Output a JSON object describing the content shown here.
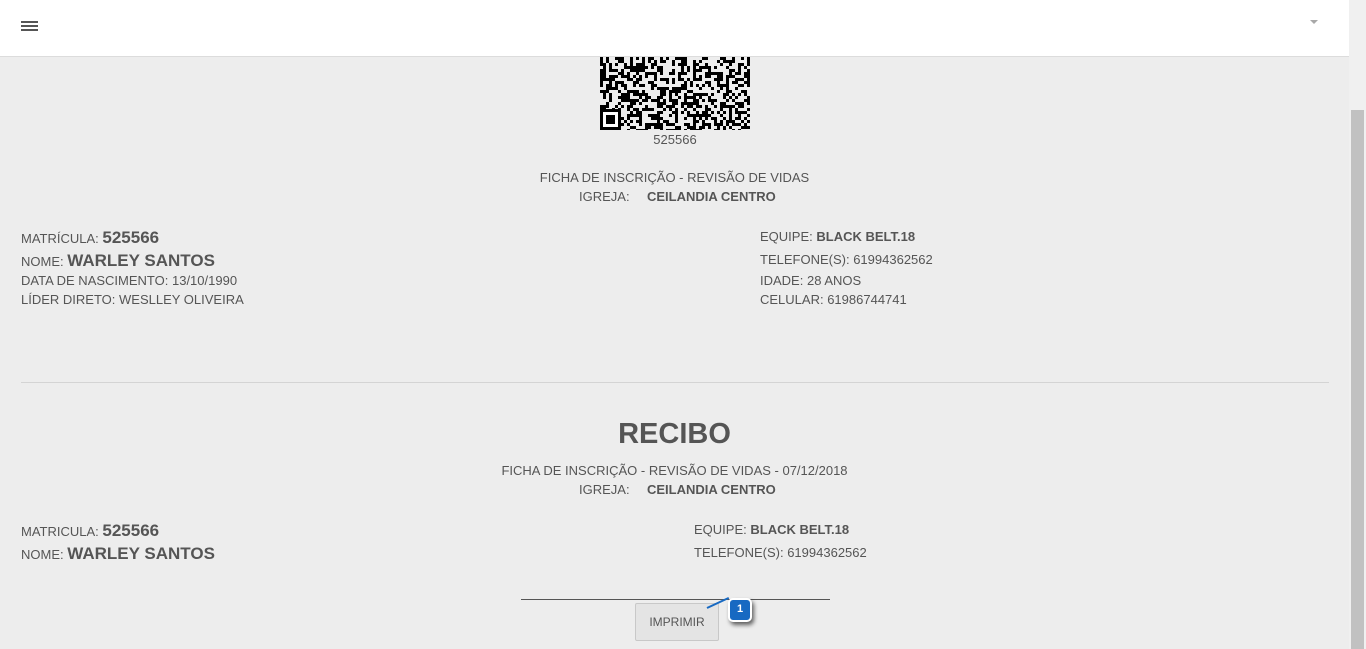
{
  "header": {
    "menu_icon": "hamburger-menu-icon",
    "dropdown_icon": "caret-down-icon"
  },
  "ficha": {
    "qr_code_number": "525566",
    "title": "FICHA DE INSCRIÇÃO - REVISÃO DE VIDAS",
    "igreja_label": "IGREJA:",
    "igreja_value": "CEILANDIA CENTRO",
    "matricula_label": "MATRÍCULA:",
    "matricula_value": "525566",
    "nome_label": "NOME:",
    "nome_value": "WARLEY SANTOS",
    "nascimento_label": "DATA DE NASCIMENTO:",
    "nascimento_value": "13/10/1990",
    "lider_label": "LÍDER DIRETO:",
    "lider_value": "WESLLEY OLIVEIRA",
    "equipe_label": "EQUIPE:",
    "equipe_value": "BLACK BELT.18",
    "telefone_label": "TELEFONE(S):",
    "telefone_value": "61994362562",
    "idade_label": "IDADE:",
    "idade_value": "28 ANOS",
    "celular_label": "CELULAR:",
    "celular_value": "61986744741"
  },
  "recibo": {
    "title": "RECIBO",
    "subtitle": "FICHA DE INSCRIÇÃO - REVISÃO DE VIDAS - 07/12/2018",
    "igreja_label": "IGREJA:",
    "igreja_value": "CEILANDIA CENTRO",
    "matricula_label": "MATRICULA:",
    "matricula_value": "525566",
    "nome_label": "NOME:",
    "nome_value": "WARLEY SANTOS",
    "equipe_label": "EQUIPE:",
    "equipe_value": "BLACK BELT.18",
    "telefone_label": "TELEFONE(S):",
    "telefone_value": "61994362562",
    "print_button": "IMPRIMIR"
  },
  "annotation": {
    "number": "1",
    "color": "#1769c2"
  }
}
